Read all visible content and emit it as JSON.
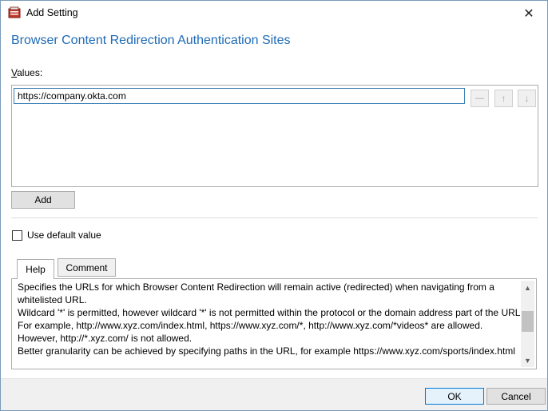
{
  "window": {
    "title": "Add Setting",
    "close_glyph": "✕"
  },
  "heading": "Browser Content Redirection Authentication Sites",
  "values": {
    "label": "Values:",
    "items": [
      "https://company.okta.com"
    ],
    "remove_glyph": "—",
    "up_glyph": "↑",
    "down_glyph": "↓"
  },
  "add_button": "Add",
  "use_default": {
    "label": "Use default value",
    "checked": false
  },
  "tabs": {
    "help": "Help",
    "comment": "Comment"
  },
  "help_text": [
    "Specifies the URLs for which Browser Content Redirection will remain active (redirected) when navigating from a whitelisted URL.",
    "Wildcard '*' is permitted, however wildcard '*' is not permitted within the protocol or the domain address part of the URL.",
    "For example, http://www.xyz.com/index.html, https://www.xyz.com/*, http://www.xyz.com/*videos* are allowed.",
    "However, http://*.xyz.com/ is not allowed.",
    "Better granularity can be achieved by specifying paths in the URL, for example https://www.xyz.com/sports/index.html"
  ],
  "footer": {
    "ok": "OK",
    "cancel": "Cancel"
  },
  "colors": {
    "heading": "#1f6bb5",
    "focus_border": "#3c7fb1",
    "ok_border": "#0078d7"
  },
  "icons": {
    "app": "settings-app-icon",
    "close": "close-icon",
    "remove": "minus-icon",
    "up": "arrow-up-icon",
    "down": "arrow-down-icon"
  }
}
